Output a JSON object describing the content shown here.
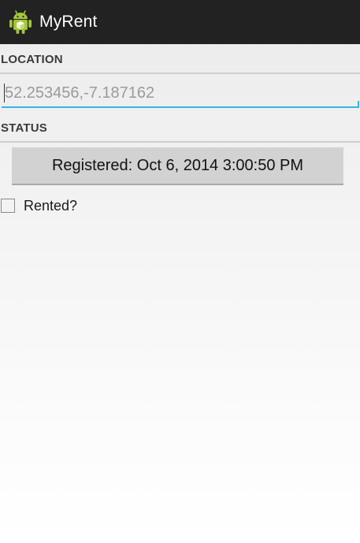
{
  "action_bar": {
    "title": "MyRent",
    "icon": "android-robot-icon",
    "background": "#222222"
  },
  "location": {
    "label": "LOCATION",
    "placeholder": "52.253456,-7.187162",
    "value": ""
  },
  "status": {
    "label": "STATUS",
    "registered_button_label": "Registered: Oct 6, 2014 3:00:50 PM",
    "rented_label": "Rented?",
    "rented_checked": false
  },
  "colors": {
    "accent": "#33b5e5",
    "android_green": "#a4c639"
  }
}
